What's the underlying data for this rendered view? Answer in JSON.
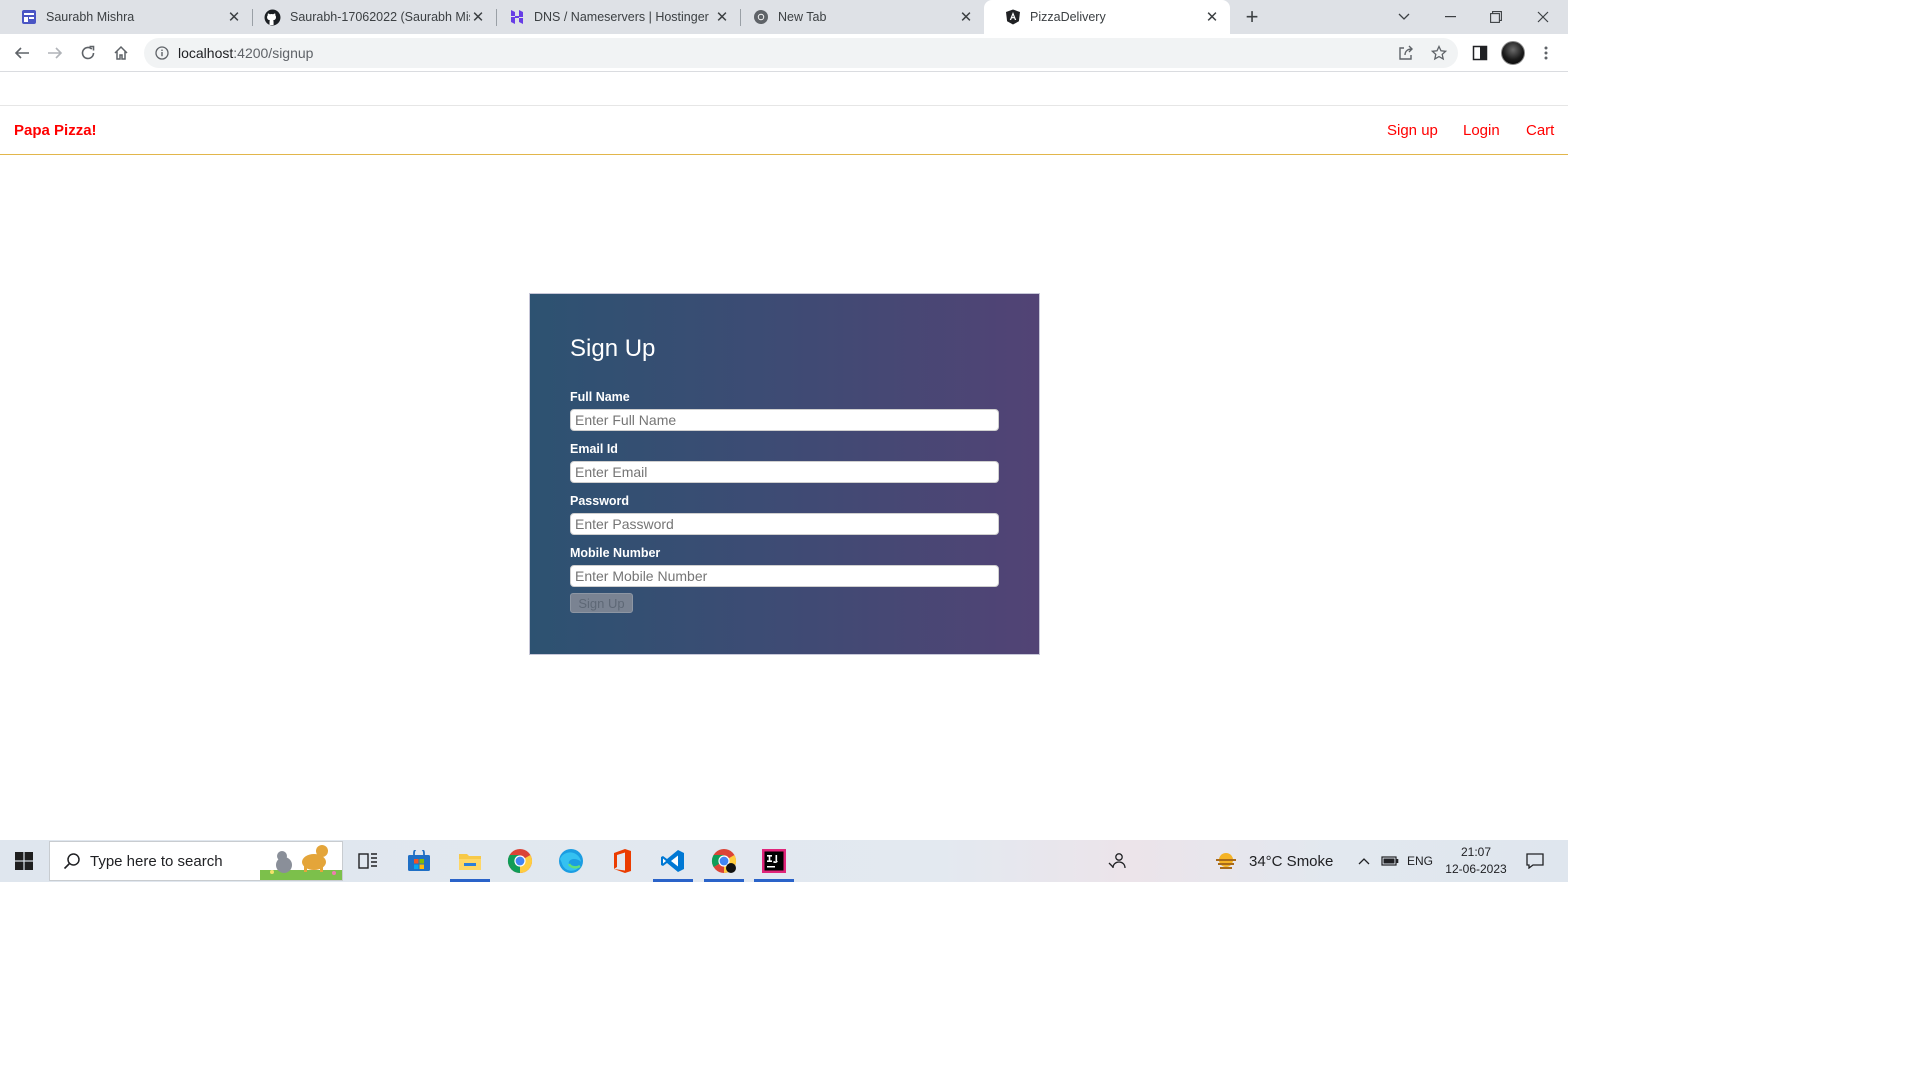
{
  "browser": {
    "tabs": [
      {
        "title": "Saurabh Mishra",
        "icon": "form-icon"
      },
      {
        "title": "Saurabh-17062022 (Saurabh Mishra)",
        "icon": "github-icon"
      },
      {
        "title": "DNS / Nameservers | Hostinger",
        "icon": "hostinger-icon"
      },
      {
        "title": "New Tab",
        "icon": "chrome-icon"
      },
      {
        "title": "PizzaDelivery",
        "icon": "angular-icon",
        "active": true
      }
    ],
    "address": {
      "host": "localhost",
      "path": ":4200/signup"
    }
  },
  "app": {
    "brand": "Papa Pizza!",
    "nav": {
      "signup": "Sign up",
      "login": "Login",
      "cart": "Cart"
    },
    "brand_color": "#ff0000"
  },
  "form": {
    "title": "Sign Up",
    "fields": [
      {
        "label": "Full Name",
        "placeholder": "Enter Full Name"
      },
      {
        "label": "Email Id",
        "placeholder": "Enter Email"
      },
      {
        "label": "Password",
        "placeholder": "Enter Password"
      },
      {
        "label": "Mobile Number",
        "placeholder": "Enter Mobile Number"
      }
    ],
    "submit": "Sign Up",
    "submit_disabled": true
  },
  "taskbar": {
    "search_placeholder": "Type here to search",
    "weather": "34°C  Smoke",
    "language": "ENG",
    "time": "21:07",
    "date": "12-06-2023"
  }
}
